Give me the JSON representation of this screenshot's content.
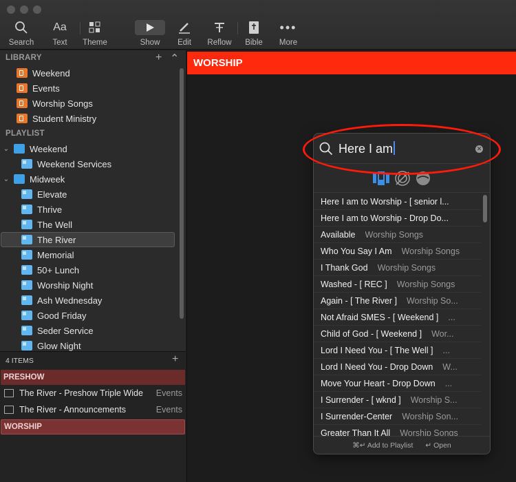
{
  "toolbar": {
    "search": "Search",
    "text": "Text",
    "theme": "Theme",
    "show": "Show",
    "edit": "Edit",
    "reflow": "Reflow",
    "bible": "Bible",
    "more": "More",
    "text_glyph": "Aa"
  },
  "sidebar": {
    "library_heading": "LIBRARY",
    "library": [
      "Weekend",
      "Events",
      "Worship Songs",
      "Student Ministry"
    ],
    "playlist_heading": "PLAYLIST",
    "playlists": [
      {
        "label": "Weekend",
        "children": [
          "Weekend Services"
        ]
      },
      {
        "label": "Midweek",
        "children": [
          "Elevate",
          "Thrive",
          "The Well",
          "The River",
          "Memorial",
          "50+ Lunch",
          "Worship Night",
          "Ash Wednesday",
          "Good Friday",
          "Seder Service",
          "Glow Night"
        ]
      }
    ],
    "selected": "The River"
  },
  "items_panel": {
    "count": "4 ITEMS",
    "groups": [
      {
        "name": "PRESHOW",
        "items": [
          {
            "title": "The River - Preshow Triple Wide",
            "library": "Events"
          },
          {
            "title": "The River - Announcements",
            "library": "Events"
          }
        ]
      },
      {
        "name": "WORSHIP",
        "items": []
      }
    ]
  },
  "main": {
    "banner": "WORSHIP"
  },
  "search": {
    "query": "Here I am",
    "results": [
      {
        "title": "Here I am to Worship - [ senior l...",
        "library": ""
      },
      {
        "title": "Here I am to Worship - Drop Do...",
        "library": ""
      },
      {
        "title": "Available",
        "library": "Worship Songs"
      },
      {
        "title": "Who You Say I Am",
        "library": "Worship Songs"
      },
      {
        "title": "I Thank God",
        "library": "Worship Songs"
      },
      {
        "title": "Washed - [ REC ]",
        "library": "Worship Songs"
      },
      {
        "title": "Again - [ The River ]",
        "library": "Worship So..."
      },
      {
        "title": "Not Afraid SMES - [ Weekend ]",
        "library": "..."
      },
      {
        "title": "Child of God - [ Weekend ]",
        "library": "Wor..."
      },
      {
        "title": "Lord I Need You  - [ The Well ]",
        "library": "..."
      },
      {
        "title": "Lord I Need You - Drop Down",
        "library": "W..."
      },
      {
        "title": "Move Your Heart - Drop Down",
        "library": "..."
      },
      {
        "title": "I Surrender - [ wknd ]",
        "library": "Worship S..."
      },
      {
        "title": "I Surrender-Center",
        "library": "Worship Son..."
      },
      {
        "title": "Greater Than It All",
        "library": "Worship Songs"
      }
    ],
    "footer_add": "⌘↵ Add to Playlist",
    "footer_open": "↵ Open"
  },
  "colors": {
    "accent": "#ff2a0e",
    "library_icon": "#e8772e",
    "playlist_icon": "#5fb6f0",
    "group": "#6b2b2b"
  }
}
